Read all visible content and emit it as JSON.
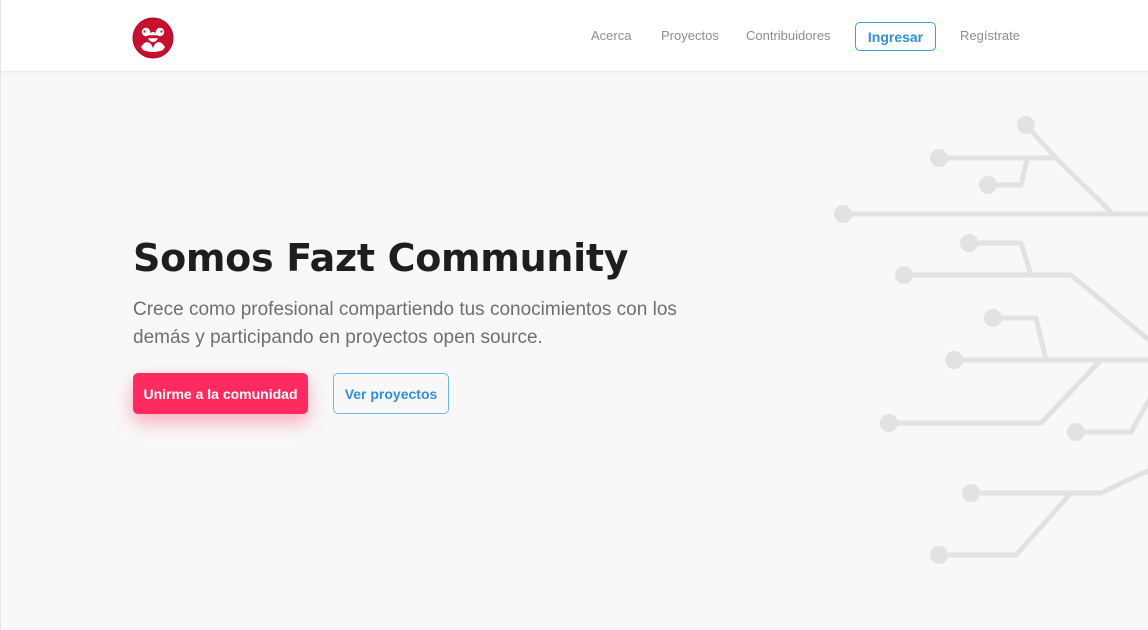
{
  "navbar": {
    "logo_icon": "fazt-community-logo-icon",
    "links": {
      "about": "Acerca",
      "projects": "Proyectos",
      "contributors": "Contribuidores",
      "login": "Ingresar",
      "register": "Regístrate"
    }
  },
  "hero": {
    "title": "Somos Fazt Community",
    "subtitle": "Crece como profesional compartiendo tus conocimientos con los demás y participando en proyectos open source.",
    "primary_button": "Unirme a la comunidad",
    "secondary_button": "Ver proyectos",
    "decoration_icon": "circuit-lines-icon"
  },
  "colors": {
    "accent_pink": "#ff2a5f",
    "accent_blue": "#2f8fd8",
    "background": "#f8f8f8",
    "logo_red": "#c8102e",
    "circuit_gray": "#e2e2e2"
  }
}
